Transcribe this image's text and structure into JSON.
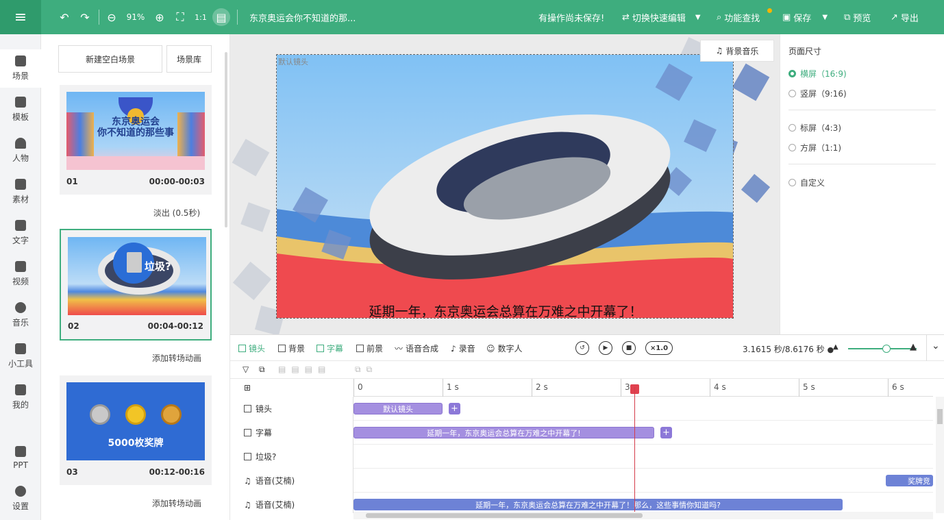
{
  "topbar": {
    "zoom": "91%",
    "title": "东京奥运会你不知道的那...",
    "unsaved": "有操作尚未保存!",
    "quick_edit": "切换快速编辑",
    "feature_search": "功能查找",
    "save": "保存",
    "preview": "预览",
    "export": "导出",
    "accent_color": "#3ead7e"
  },
  "sidebar": {
    "items": [
      {
        "label": "场景",
        "icon": "scene-icon"
      },
      {
        "label": "模板",
        "icon": "template-icon"
      },
      {
        "label": "人物",
        "icon": "person-icon"
      },
      {
        "label": "素材",
        "icon": "material-icon"
      },
      {
        "label": "文字",
        "icon": "text-icon"
      },
      {
        "label": "视频",
        "icon": "video-icon"
      },
      {
        "label": "音乐",
        "icon": "music-icon"
      },
      {
        "label": "小工具",
        "icon": "toolbox-icon"
      },
      {
        "label": "我的",
        "icon": "upload-icon"
      },
      {
        "label": "PPT",
        "icon": "ppt-icon"
      },
      {
        "label": "设置",
        "icon": "gear-icon"
      }
    ]
  },
  "scenes_panel": {
    "new_blank": "新建空白场景",
    "library": "场景库",
    "scenes": [
      {
        "num": "01",
        "time": "00:00-00:03",
        "thumb_text": "东京奥运会\n你不知道的那些事"
      },
      {
        "num": "02",
        "time": "00:04-00:12",
        "thumb_text": "垃圾?"
      },
      {
        "num": "03",
        "time": "00:12-00:16",
        "thumb_text": "5000枚奖牌"
      }
    ],
    "transitions": [
      "淡出 (0.5秒)",
      "添加转场动画",
      "添加转场动画"
    ]
  },
  "canvas": {
    "camera_label": "默认镜头",
    "bgm": "背景音乐",
    "subtitle": "延期一年，东京奥运会总算在万难之中开幕了！"
  },
  "properties": {
    "heading": "页面尺寸",
    "options": [
      "横屏（16:9)",
      "竖屏（9:16)",
      "标屏（4:3)",
      "方屏（1:1)",
      "自定义"
    ],
    "selected": "横屏（16:9)"
  },
  "timeline": {
    "tabs": [
      "镜头",
      "背景",
      "字幕",
      "前景",
      "语音合成",
      "录音",
      "数字人"
    ],
    "speed": "×1.0",
    "time_display": "3.1615 秒/8.6176 秒",
    "ruler": [
      "0",
      "1 s",
      "2 s",
      "3",
      "4 s",
      "5 s",
      "6 s"
    ],
    "tracks": [
      "镜头",
      "字幕",
      "垃圾?",
      "语音(艾楠)",
      "语音(艾楠)"
    ],
    "clips": {
      "camera": "默认镜头",
      "subtitle": "延期一年，东京奥运会总算在万难之中开幕了!",
      "voice1": "奖牌竞",
      "voice2": "延期一年，东京奥运会总算在万难之中开幕了！那么，这些事情你知道吗?"
    }
  }
}
